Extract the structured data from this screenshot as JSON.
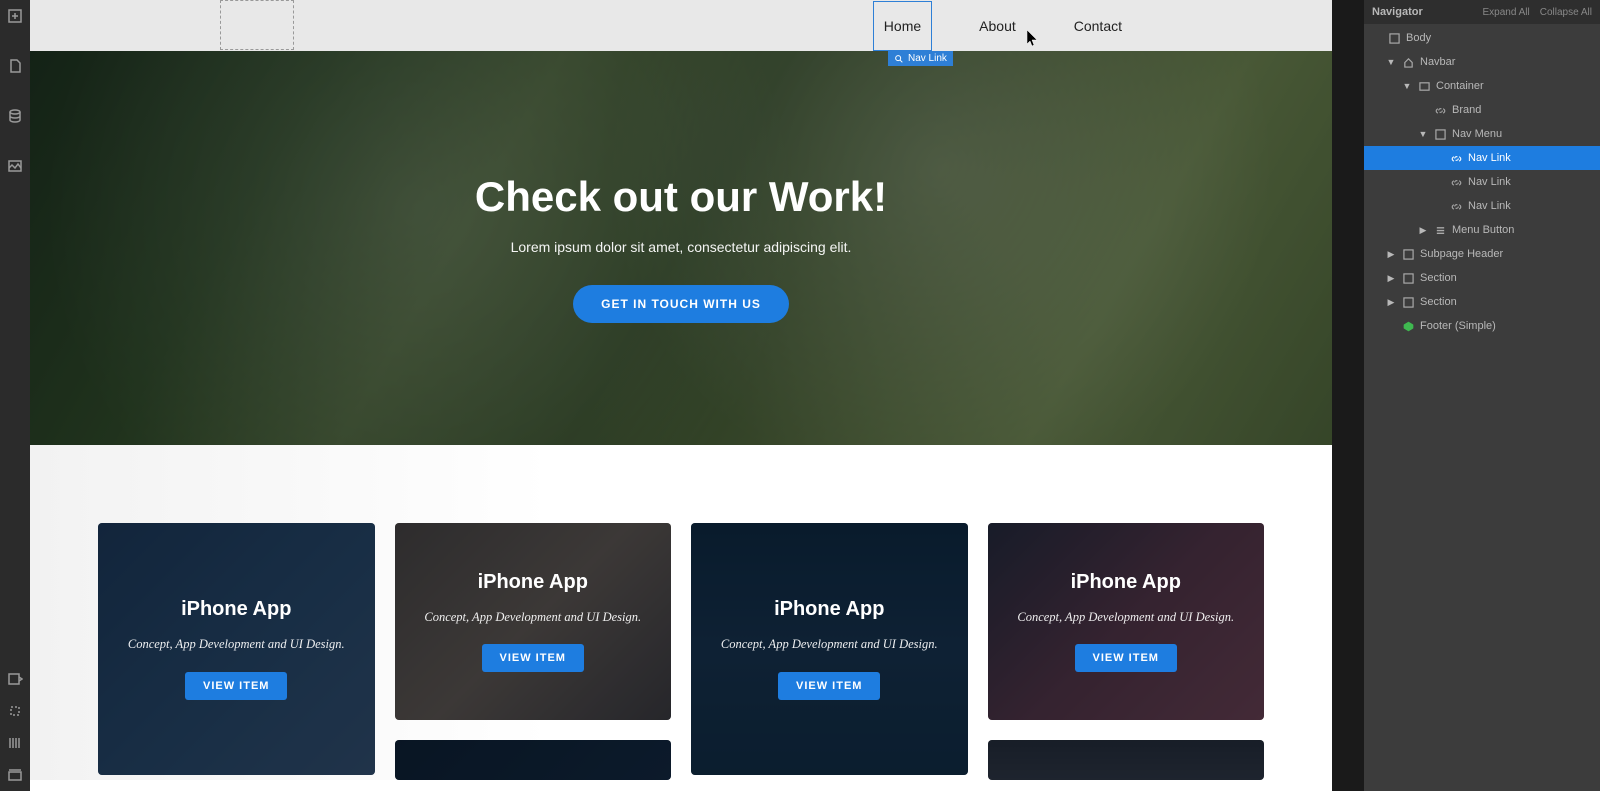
{
  "navigator": {
    "title": "Navigator",
    "expand": "Expand All",
    "collapse": "Collapse All",
    "tree": [
      {
        "label": "Body",
        "icon": "box",
        "indent": 0,
        "arrow": ""
      },
      {
        "label": "Navbar",
        "icon": "home",
        "indent": 1,
        "arrow": "down"
      },
      {
        "label": "Container",
        "icon": "container",
        "indent": 2,
        "arrow": "down"
      },
      {
        "label": "Brand",
        "icon": "link",
        "indent": 3,
        "arrow": ""
      },
      {
        "label": "Nav Menu",
        "icon": "box",
        "indent": 3,
        "arrow": "down"
      },
      {
        "label": "Nav Link",
        "icon": "link",
        "indent": 4,
        "arrow": "",
        "selected": true
      },
      {
        "label": "Nav Link",
        "icon": "link",
        "indent": 4,
        "arrow": ""
      },
      {
        "label": "Nav Link",
        "icon": "link",
        "indent": 4,
        "arrow": ""
      },
      {
        "label": "Menu Button",
        "icon": "menu",
        "indent": 3,
        "arrow": "right"
      },
      {
        "label": "Subpage Header",
        "icon": "box",
        "indent": 1,
        "arrow": "right"
      },
      {
        "label": "Section",
        "icon": "box",
        "indent": 1,
        "arrow": "right"
      },
      {
        "label": "Section",
        "icon": "box",
        "indent": 1,
        "arrow": "right"
      },
      {
        "label": "Footer (Simple)",
        "icon": "component",
        "indent": 1,
        "arrow": ""
      }
    ]
  },
  "selection_tag": "Nav Link",
  "nav": {
    "items": [
      "Home",
      "About",
      "Contact"
    ],
    "selected_index": 0
  },
  "hero": {
    "title": "Check out our Work!",
    "subtitle": "Lorem ipsum dolor sit amet, consectetur adipiscing elit.",
    "cta": "GET IN TOUCH WITH US"
  },
  "cards": [
    {
      "title": "iPhone App",
      "desc": "Concept, App Development and UI Design.",
      "cta": "VIEW ITEM",
      "tall": true,
      "bg": "bg1"
    },
    {
      "title": "iPhone App",
      "desc": "Concept, App Development and UI Design.",
      "cta": "VIEW ITEM",
      "tall": false,
      "bg": "bg2"
    },
    {
      "title": "iPhone App",
      "desc": "Concept, App Development and UI Design.",
      "cta": "VIEW ITEM",
      "tall": true,
      "bg": "bg3"
    },
    {
      "title": "iPhone App",
      "desc": "Concept, App Development and UI Design.",
      "cta": "VIEW ITEM",
      "tall": false,
      "bg": "bg4"
    }
  ]
}
